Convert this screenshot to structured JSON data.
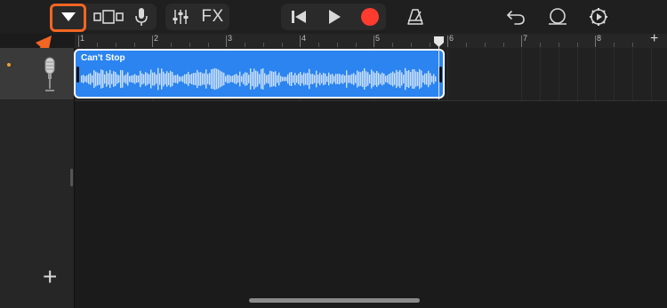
{
  "toolbar": {
    "buttons": [
      {
        "name": "view-dropdown",
        "icon": "triangle-down-icon"
      },
      {
        "name": "browser",
        "icon": "tracks-view-icon"
      },
      {
        "name": "smart-controls",
        "icon": "microphone-icon"
      },
      {
        "name": "mixer",
        "icon": "sliders-icon"
      },
      {
        "name": "effects",
        "label": "FX"
      },
      {
        "name": "go-to-beginning",
        "icon": "skip-back-icon"
      },
      {
        "name": "play",
        "icon": "play-icon"
      },
      {
        "name": "record",
        "icon": "record-icon"
      },
      {
        "name": "metronome",
        "icon": "metronome-icon"
      },
      {
        "name": "undo",
        "icon": "undo-icon"
      },
      {
        "name": "loop-browser",
        "icon": "loop-icon"
      },
      {
        "name": "settings",
        "icon": "gear-icon"
      }
    ],
    "fx_label": "FX"
  },
  "ruler": {
    "bar_numbers": [
      "1",
      "2",
      "3",
      "4",
      "5",
      "6",
      "7",
      "8"
    ],
    "add_section_label": "+"
  },
  "track": {
    "name_icon": "microphone-icon",
    "region": {
      "name": "Can't Stop",
      "color": "#2b84ef"
    }
  },
  "sidebar": {
    "add_track_label": "+"
  },
  "annotation": {
    "highlight_color": "#f26522"
  }
}
